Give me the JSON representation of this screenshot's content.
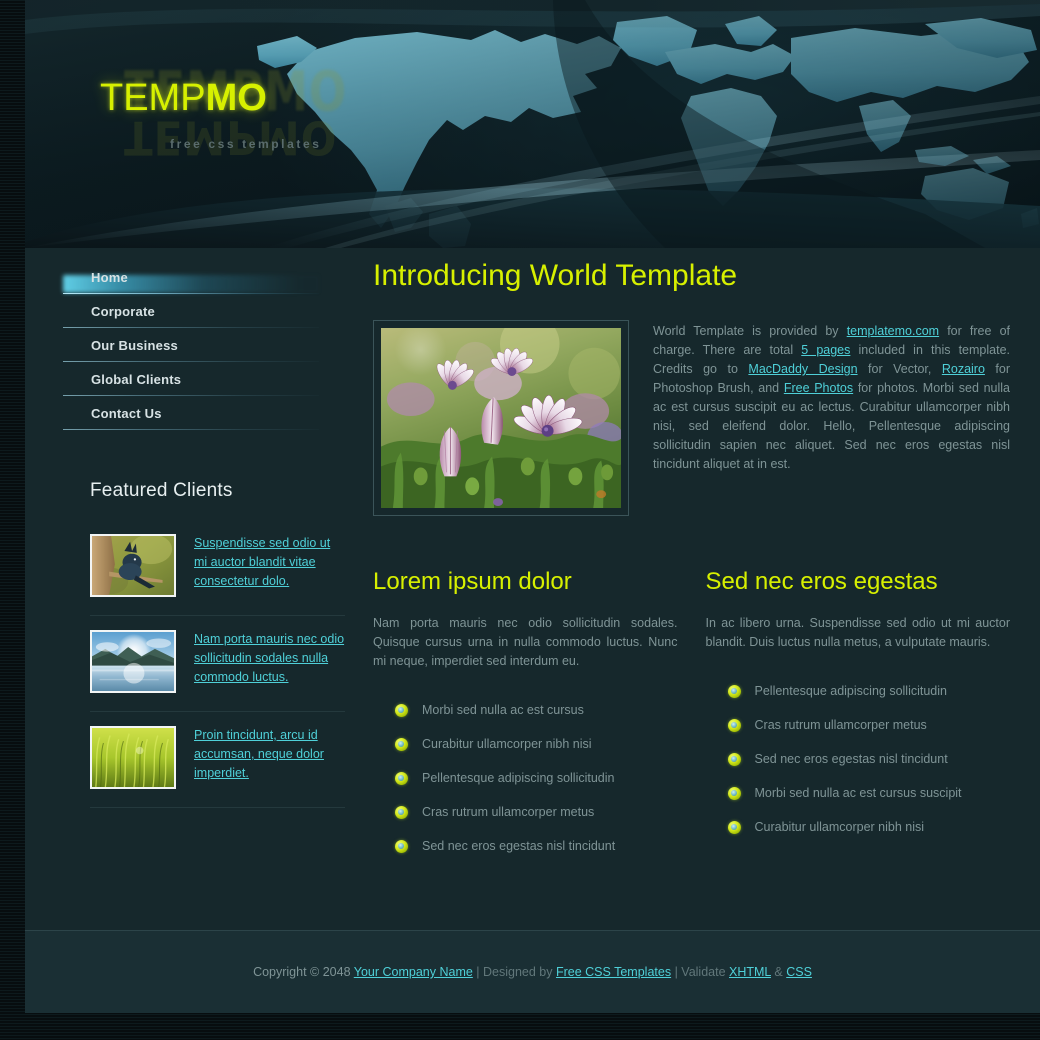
{
  "header": {
    "logo_normal": "TEMP",
    "logo_bold": "MO",
    "logo_full": "TEMPMO",
    "tagline": "free css templates"
  },
  "sidebar": {
    "menu": [
      {
        "label": "Home",
        "active": true
      },
      {
        "label": "Corporate",
        "active": false
      },
      {
        "label": "Our Business",
        "active": false
      },
      {
        "label": "Global Clients",
        "active": false
      },
      {
        "label": "Contact Us",
        "active": false
      }
    ],
    "featured_heading": "Featured Clients",
    "clients": [
      {
        "image": "bird-on-branch-thumbnail",
        "link_text": "Suspendisse sed odio ut mi auctor blandit vitae consectetur dolo."
      },
      {
        "image": "lake-mountain-thumbnail",
        "link_text": "Nam porta mauris nec odio sollicitudin sodales nulla commodo luctus."
      },
      {
        "image": "green-grass-thumbnail",
        "link_text": "Proin tincidunt, arcu id accumsan, neque dolor imperdiet."
      }
    ]
  },
  "main": {
    "page_title": "Introducing World Template",
    "intro_image": "purple-white-daisies-photo",
    "intro_paragraph": {
      "part1": "World Template is provided by ",
      "link1": "templatemo.com",
      "part2": " for free of charge. There are total ",
      "link2": "5 pages",
      "part3": " included in this template. Credits go to ",
      "link3": "MacDaddy Design",
      "part4": " for Vector, ",
      "link4": "Rozairo",
      "part5": " for Photoshop Brush, and ",
      "link5": "Free Photos",
      "part6": " for photos. Morbi sed nulla ac est cursus suscipit eu ac lectus. Curabitur ullamcorper nibh nisi, sed eleifend dolor. Hello, Pellentesque adipiscing sollicitudin sapien nec aliquet. Sed nec eros egestas nisl tincidunt aliquet at in est."
    },
    "columns": [
      {
        "heading": "Lorem ipsum dolor",
        "paragraph": "Nam porta mauris nec odio sollicitudin sodales. Quisque cursus urna in nulla commodo luctus. Nunc mi neque, imperdiet sed interdum eu.",
        "bullets": [
          "Morbi sed nulla ac est cursus",
          "Curabitur ullamcorper nibh nisi",
          "Pellentesque adipiscing sollicitudin",
          "Cras rutrum ullamcorper metus",
          "Sed nec eros egestas nisl tincidunt"
        ]
      },
      {
        "heading": "Sed nec eros egestas",
        "paragraph": "In ac libero urna. Suspendisse sed odio ut mi auctor blandit. Duis luctus nulla metus, a vulputate mauris.",
        "bullets": [
          "Pellentesque adipiscing sollicitudin",
          "Cras rutrum ullamcorper metus",
          "Sed nec eros egestas nisl tincidunt",
          "Morbi sed nulla ac est cursus suscipit",
          "Curabitur ullamcorper nibh nisi"
        ]
      }
    ]
  },
  "footer": {
    "copyright_prefix": "Copyright © 2048 ",
    "company_link": "Your Company Name",
    "designed_by_prefix": " | Designed by ",
    "designer_link": "Free CSS Templates",
    "validate_prefix": " | Validate ",
    "xhtml_link": "XHTML",
    "amp": " & ",
    "css_link": "CSS"
  },
  "colors": {
    "accent_yellow": "#d7f000",
    "link_cyan": "#4fd0d8",
    "page_bg": "#16282c",
    "footer_bg": "#1a2f34",
    "map_blue": "#6fc6de",
    "text_gray": "#7f9496"
  }
}
